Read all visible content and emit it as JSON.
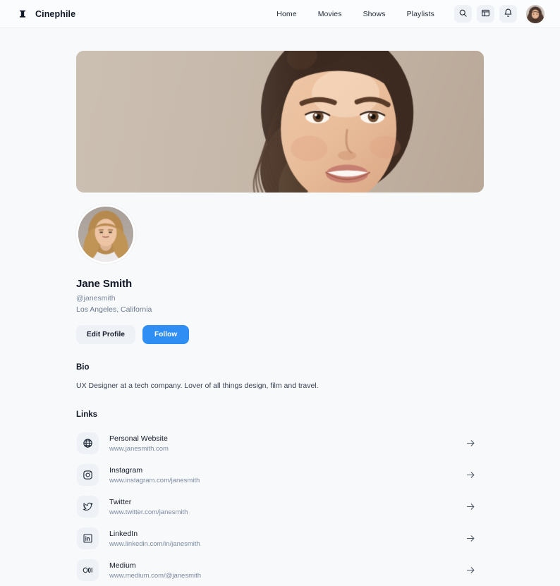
{
  "header": {
    "brand": {
      "name": "Cinephile",
      "icon": "film-reel-icon"
    },
    "nav_links": [
      {
        "label": "Home"
      },
      {
        "label": "Movies"
      },
      {
        "label": "Shows"
      },
      {
        "label": "Playlists"
      }
    ],
    "icon_buttons": [
      {
        "name": "search-icon",
        "label": "Search"
      },
      {
        "name": "layout-panel-icon",
        "label": "Layout"
      },
      {
        "name": "bell-icon",
        "label": "Notifications"
      }
    ],
    "avatar": {
      "name": "user-avatar",
      "alt": "Account avatar"
    }
  },
  "profile": {
    "cover": {
      "alt": "Cover photo portrait",
      "background_color": "#c3b4a6"
    },
    "avatar": {
      "alt": "Jane Smith profile photo"
    },
    "name": "Jane Smith",
    "handle": "@janesmith",
    "location": "Los Angeles, California",
    "edit_button": "Edit Profile",
    "follow_button": "Follow",
    "bio_heading": "Bio",
    "bio_text": "UX Designer at a tech company. Lover of all things design, film and travel.",
    "links_heading": "Links",
    "links": [
      {
        "icon": "globe-icon",
        "title": "Personal Website",
        "url": "www.janesmith.com"
      },
      {
        "icon": "instagram-icon",
        "title": "Instagram",
        "url": "www.instagram.com/janesmith"
      },
      {
        "icon": "twitter-icon",
        "title": "Twitter",
        "url": "www.twitter.com/janesmith"
      },
      {
        "icon": "linkedin-icon",
        "title": "LinkedIn",
        "url": "www.linkedin.com/in/janesmith"
      },
      {
        "icon": "medium-icon",
        "title": "Medium",
        "url": "www.medium.com/@janesmith"
      }
    ]
  },
  "colors": {
    "background": "#f8f9fb",
    "accent": "#2f8ef4",
    "muted_text": "#7b8aa0",
    "icon_chip": "#eef1f5"
  }
}
